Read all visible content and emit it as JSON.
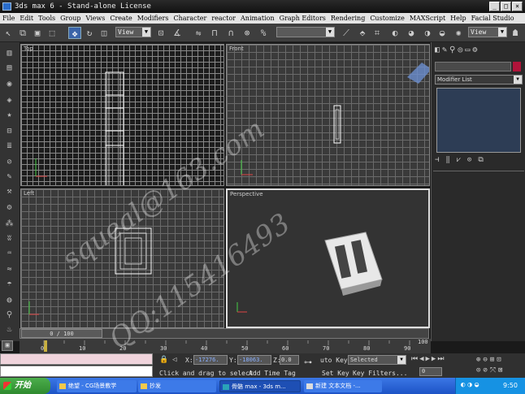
{
  "window": {
    "title": "3ds max 6 - Stand-alone License",
    "minimize": "_",
    "maximize": "□",
    "close": "×"
  },
  "menu": [
    "File",
    "Edit",
    "Tools",
    "Group",
    "Views",
    "Create",
    "Modifiers",
    "Character",
    "reactor",
    "Animation",
    "Graph Editors",
    "Rendering",
    "Customize",
    "MAXScript",
    "Help",
    "Facial Studio"
  ],
  "toolbar": {
    "view_dropdown": "View",
    "view_dropdown2": "View",
    "named_selection": ""
  },
  "viewports": {
    "top": "Top",
    "front": "Front",
    "left": "Left",
    "perspective": "Perspective"
  },
  "command_panel": {
    "modifier_list": "Modifier List"
  },
  "time": {
    "slider": "0 / 100",
    "ticks": [
      "0",
      "10",
      "20",
      "30",
      "40",
      "50",
      "60",
      "70",
      "80",
      "90",
      "100"
    ]
  },
  "status": {
    "x_label": "X:",
    "x_value": "-17276.",
    "y_label": "Y:",
    "y_value": "-18063.",
    "z_label": "Z:",
    "z_value": "0.0",
    "prompt": "Click and drag to select",
    "add_time_tag": "Add Time Tag",
    "auto_key": "uto Key",
    "selected": "Selected",
    "set_key": "Set Key",
    "key_filters": "Key Filters...",
    "frame": "0"
  },
  "watermark": {
    "line1": "squeal@163.com",
    "line2": "QQ:115416493"
  },
  "taskbar": {
    "start": "开始",
    "tasks": [
      "绝望 - CG场景教学",
      "抄发",
      "骨骼 max - 3ds m...",
      "新建 文本文档 -..."
    ],
    "clock": "9:50"
  },
  "colors": {
    "selection_blue": "#3a64a8",
    "taskbar_blue": "#2c64d6",
    "start_green": "#3c9a3c"
  }
}
